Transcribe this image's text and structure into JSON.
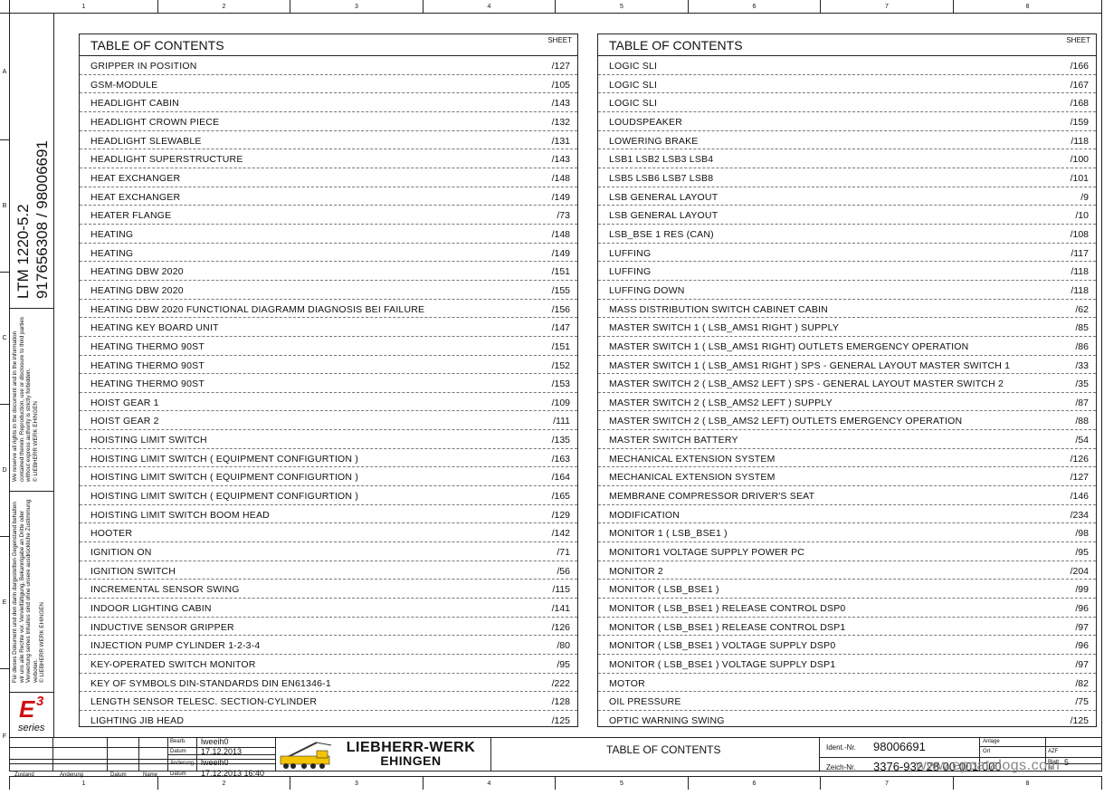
{
  "ruler": {
    "columns": [
      "1",
      "2",
      "3",
      "4",
      "5",
      "6",
      "7",
      "8"
    ],
    "rows": [
      "A",
      "B",
      "C",
      "D",
      "E",
      "F"
    ]
  },
  "strip": {
    "model": "LTM 1220-5.2",
    "numbers": "917656308  /  98006691",
    "notice_en": "We reserve all rights in the document and in the information contained therein. Reproduction, use or disclosure to third parties without express authority is strictly forbidden.",
    "notice_en_copy": "© LIEBHERR WERK EHINGEN",
    "notice_de": "Für dieses Dokument und den darin dargestellten Gegenstand behalten wir uns alle Rechte vor. Vervielfältigung, Bekanntgabe an Dritte oder Verwertung seines Inhaltes sind ohne unsere ausdrückliche Zustimmung verboten.",
    "notice_de_copy": "© LIEBHERR WERK EHINGEN",
    "logo_main": "E",
    "logo_sup": "3",
    "logo_sub": "series"
  },
  "toc_left": {
    "title": "TABLE OF CONTENTS",
    "sheet_label": "SHEET",
    "rows": [
      {
        "text": "GRIPPER IN POSITION",
        "page": "/127"
      },
      {
        "text": "GSM-MODULE",
        "page": "/105"
      },
      {
        "text": "HEADLIGHT CABIN",
        "page": "/143"
      },
      {
        "text": "HEADLIGHT CROWN PIECE",
        "page": "/132"
      },
      {
        "text": "HEADLIGHT SLEWABLE",
        "page": "/131"
      },
      {
        "text": "HEADLIGHT SUPERSTRUCTURE",
        "page": "/143"
      },
      {
        "text": "HEAT EXCHANGER",
        "page": "/148"
      },
      {
        "text": "HEAT EXCHANGER",
        "page": "/149"
      },
      {
        "text": "HEATER FLANGE",
        "page": "/73"
      },
      {
        "text": "HEATING",
        "page": "/148"
      },
      {
        "text": "HEATING",
        "page": "/149"
      },
      {
        "text": "HEATING DBW 2020",
        "page": "/151"
      },
      {
        "text": "HEATING DBW 2020",
        "page": "/155"
      },
      {
        "text": "HEATING DBW 2020 FUNCTIONAL DIAGRAMM DIAGNOSIS BEI FAILURE",
        "page": "/156"
      },
      {
        "text": "HEATING KEY BOARD UNIT",
        "page": "/147"
      },
      {
        "text": "HEATING THERMO 90ST",
        "page": "/151"
      },
      {
        "text": "HEATING THERMO 90ST",
        "page": "/152"
      },
      {
        "text": "HEATING THERMO 90ST",
        "page": "/153"
      },
      {
        "text": "HOIST GEAR 1",
        "page": "/109"
      },
      {
        "text": "HOIST GEAR 2",
        "page": "/111"
      },
      {
        "text": "HOISTING LIMIT SWITCH",
        "page": "/135"
      },
      {
        "text": "HOISTING LIMIT SWITCH ( EQUIPMENT CONFIGURTION )",
        "page": "/163"
      },
      {
        "text": "HOISTING LIMIT SWITCH ( EQUIPMENT CONFIGURTION )",
        "page": "/164"
      },
      {
        "text": "HOISTING LIMIT SWITCH ( EQUIPMENT CONFIGURTION )",
        "page": "/165"
      },
      {
        "text": "HOISTING LIMIT SWITCH BOOM HEAD",
        "page": "/129"
      },
      {
        "text": "HOOTER",
        "page": "/142"
      },
      {
        "text": "IGNITION ON",
        "page": "/71"
      },
      {
        "text": "IGNITION SWITCH",
        "page": "/56"
      },
      {
        "text": "INCREMENTAL SENSOR SWING",
        "page": "/115"
      },
      {
        "text": "INDOOR LIGHTING CABIN",
        "page": "/141"
      },
      {
        "text": "INDUCTIVE SENSOR GRIPPER",
        "page": "/126"
      },
      {
        "text": "INJECTION PUMP CYLINDER 1-2-3-4",
        "page": "/80"
      },
      {
        "text": "KEY-OPERATED SWITCH MONITOR",
        "page": "/95"
      },
      {
        "text": "KEY OF SYMBOLS DIN-STANDARDS DIN EN61346-1",
        "page": "/222"
      },
      {
        "text": "LENGTH SENSOR TELESC. SECTION-CYLINDER",
        "page": "/128"
      },
      {
        "text": "LIGHTING JIB HEAD",
        "page": "/125"
      }
    ]
  },
  "toc_right": {
    "title": "TABLE OF CONTENTS",
    "sheet_label": "SHEET",
    "rows": [
      {
        "text": "LOGIC SLI",
        "page": "/166"
      },
      {
        "text": "LOGIC SLI",
        "page": "/167"
      },
      {
        "text": "LOGIC SLI",
        "page": "/168"
      },
      {
        "text": "LOUDSPEAKER",
        "page": "/159"
      },
      {
        "text": "LOWERING BRAKE",
        "page": "/118"
      },
      {
        "text": "LSB1 LSB2 LSB3 LSB4",
        "page": "/100"
      },
      {
        "text": "LSB5  LSB6  LSB7  LSB8",
        "page": "/101"
      },
      {
        "text": "LSB GENERAL LAYOUT",
        "page": "/9"
      },
      {
        "text": "LSB GENERAL LAYOUT",
        "page": "/10"
      },
      {
        "text": "LSB_BSE 1 RES (CAN)",
        "page": "/108"
      },
      {
        "text": "LUFFING",
        "page": "/117"
      },
      {
        "text": "LUFFING",
        "page": "/118"
      },
      {
        "text": "LUFFING DOWN",
        "page": "/118"
      },
      {
        "text": "MASS DISTRIBUTION SWITCH CABINET CABIN",
        "page": "/62"
      },
      {
        "text": "MASTER SWITCH 1 ( LSB_AMS1 RIGHT ) SUPPLY",
        "page": "/85"
      },
      {
        "text": "MASTER SWITCH 1 ( LSB_AMS1 RIGHT) OUTLETS EMERGENCY OPERATION",
        "page": "/86"
      },
      {
        "text": "MASTER SWITCH 1 ( LSB_AMS1 RIGHT ) SPS - GENERAL LAYOUT MASTER SWITCH 1",
        "page": "/33"
      },
      {
        "text": "MASTER SWITCH 2 ( LSB_AMS2 LEFT ) SPS - GENERAL LAYOUT MASTER SWITCH 2",
        "page": "/35"
      },
      {
        "text": "MASTER SWITCH 2 ( LSB_AMS2 LEFT ) SUPPLY",
        "page": "/87"
      },
      {
        "text": "MASTER SWITCH 2 ( LSB_AMS2 LEFT) OUTLETS EMERGENCY OPERATION",
        "page": "/88"
      },
      {
        "text": "MASTER SWITCH BATTERY",
        "page": "/54"
      },
      {
        "text": "MECHANICAL EXTENSION SYSTEM",
        "page": "/126"
      },
      {
        "text": "MECHANICAL EXTENSION SYSTEM",
        "page": "/127"
      },
      {
        "text": "MEMBRANE COMPRESSOR DRIVER'S SEAT",
        "page": "/146"
      },
      {
        "text": "MODIFICATION",
        "page": "/234"
      },
      {
        "text": "MONITOR 1 ( LSB_BSE1 )",
        "page": "/98"
      },
      {
        "text": "MONITOR1 VOLTAGE SUPPLY POWER PC",
        "page": "/95"
      },
      {
        "text": "MONITOR 2",
        "page": "/204"
      },
      {
        "text": "MONITOR ( LSB_BSE1 )",
        "page": "/99"
      },
      {
        "text": "MONITOR ( LSB_BSE1 ) RELEASE CONTROL DSP0",
        "page": "/96"
      },
      {
        "text": "MONITOR ( LSB_BSE1 ) RELEASE CONTROL DSP1",
        "page": "/97"
      },
      {
        "text": "MONITOR ( LSB_BSE1 ) VOLTAGE SUPPLY DSP0",
        "page": "/96"
      },
      {
        "text": "MONITOR ( LSB_BSE1 ) VOLTAGE SUPPLY DSP1",
        "page": "/97"
      },
      {
        "text": "MOTOR",
        "page": "/82"
      },
      {
        "text": "OIL PRESSURE",
        "page": "/75"
      },
      {
        "text": "OPTIC WARNING SWING",
        "page": "/125"
      }
    ]
  },
  "title_block": {
    "bearb_label": "Bearb.",
    "bearb_value": "lweeih0",
    "datum_label": "Datum",
    "datum_value": "17.12.2013",
    "aenderung_label": "Änderung",
    "aenderung_value": "lweeih0",
    "datum2_label": "Datum",
    "datum2_value": "17.12.2013  16:40",
    "zustand_label": "Zustand",
    "aend_label": "Änderung",
    "dat_label": "Datum",
    "name_label": "Name",
    "company_line1": "LIEBHERR-WERK",
    "company_line2": "EHINGEN",
    "drawing_title": "TABLE OF CONTENTS",
    "ident_label": "Ident.-Nr.",
    "ident_value": "98006691",
    "zeich_label": "Zeich-Nr.",
    "zeich_value": "3376-932 28 00 001  000",
    "anlage_label": "Anlage",
    "ort_label": "Ort",
    "azf_label": "AZF",
    "blatt_label": "Blatt",
    "blatt_value": "5",
    "bl_label": "Bl",
    "watermark": "www.epcatalogs.com"
  }
}
